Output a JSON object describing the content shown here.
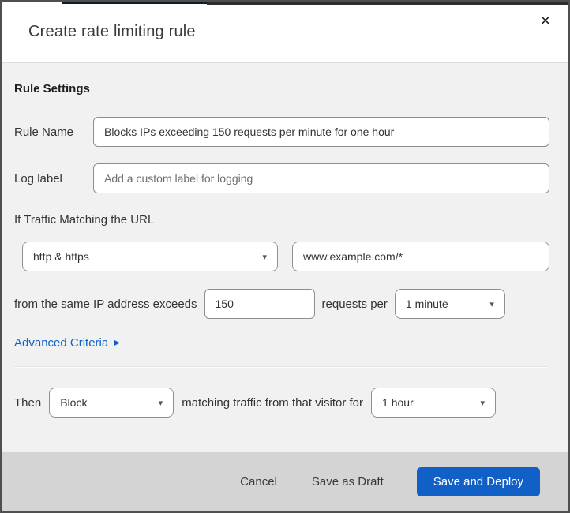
{
  "modal": {
    "title": "Create rate limiting rule",
    "icons": {
      "close": "✕",
      "caret": "▾",
      "arrow_right": "▶"
    },
    "colors": {
      "primary_button": "#1160c8",
      "link": "#0c62c8",
      "footer_background": "#d4d4d4",
      "body_background": "#f1f1f2"
    },
    "rule_settings": {
      "heading": "Rule Settings",
      "rule_name": {
        "label": "Rule Name",
        "value": "Blocks IPs exceeding 150 requests per minute for one hour"
      },
      "log_label": {
        "label": "Log label",
        "placeholder": "Add a custom label for logging"
      }
    },
    "traffic": {
      "heading": "If Traffic Matching the URL",
      "scheme_value": "http & https",
      "url_value": "www.example.com/*",
      "threshold_prefix": "from the same IP address exceeds",
      "count_value": "150",
      "threshold_middle": "requests per",
      "period_value": "1 minute",
      "advanced_label": "Advanced Criteria"
    },
    "action": {
      "prefix": "Then",
      "action_value": "Block",
      "middle": "matching traffic from that visitor for",
      "duration_value": "1 hour"
    },
    "footer": {
      "cancel": "Cancel",
      "save_draft": "Save as Draft",
      "save_deploy": "Save and Deploy"
    }
  }
}
